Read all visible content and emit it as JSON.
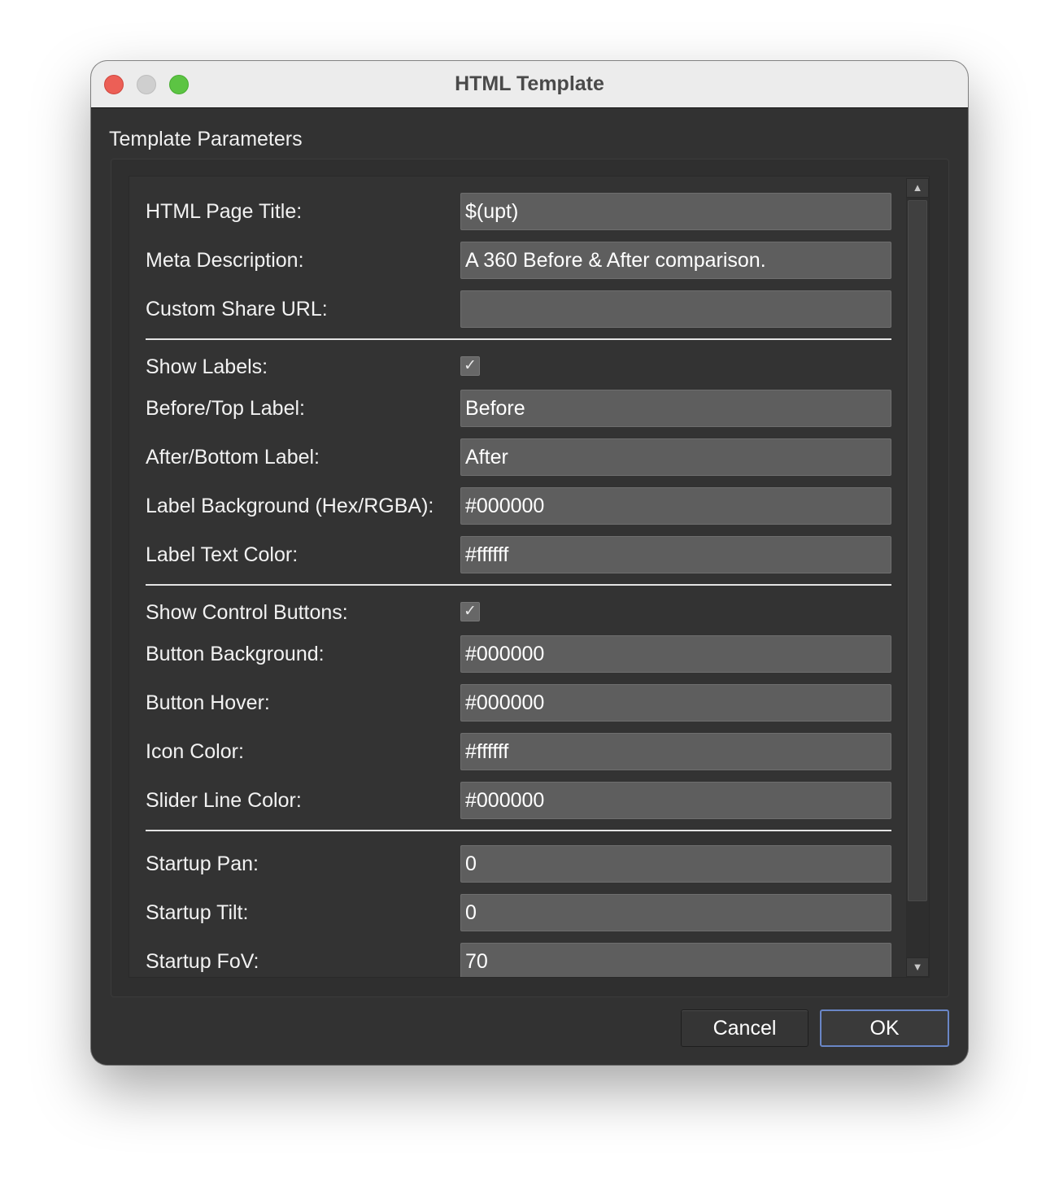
{
  "window": {
    "title": "HTML Template"
  },
  "group": {
    "title": "Template Parameters"
  },
  "fields": [
    {
      "label": "HTML Page Title:",
      "value": "$(upt)"
    },
    {
      "label": "Meta Description:",
      "value": "A 360 Before & After comparison."
    },
    {
      "label": "Custom Share URL:",
      "value": ""
    },
    {
      "label": "Show Labels:",
      "checked": true,
      "check_glyph": "✓"
    },
    {
      "label": "Before/Top Label:",
      "value": "Before"
    },
    {
      "label": "After/Bottom Label:",
      "value": "After"
    },
    {
      "label": "Label Background (Hex/RGBA):",
      "value": "#000000"
    },
    {
      "label": "Label Text Color:",
      "value": "#ffffff"
    },
    {
      "label": "Show Control Buttons:",
      "checked": true,
      "check_glyph": "✓"
    },
    {
      "label": "Button Background:",
      "value": "#000000"
    },
    {
      "label": "Button Hover:",
      "value": "#000000"
    },
    {
      "label": "Icon Color:",
      "value": "#ffffff"
    },
    {
      "label": "Slider Line Color:",
      "value": "#000000"
    },
    {
      "label": "Startup Pan:",
      "value": "0"
    },
    {
      "label": "Startup Tilt:",
      "value": "0"
    },
    {
      "label": "Startup FoV:",
      "value": "70"
    }
  ],
  "scrollbar": {
    "up_glyph": "▲",
    "down_glyph": "▼"
  },
  "buttons": {
    "cancel_label": "Cancel",
    "ok_label": "OK"
  },
  "colors": {
    "window_bg": "#323232",
    "field_bg": "#5e5e5e",
    "default_button_border": "#6a86c6",
    "close": "#ec5f56",
    "minimize": "#cfcfcf",
    "zoom": "#5cc443"
  }
}
